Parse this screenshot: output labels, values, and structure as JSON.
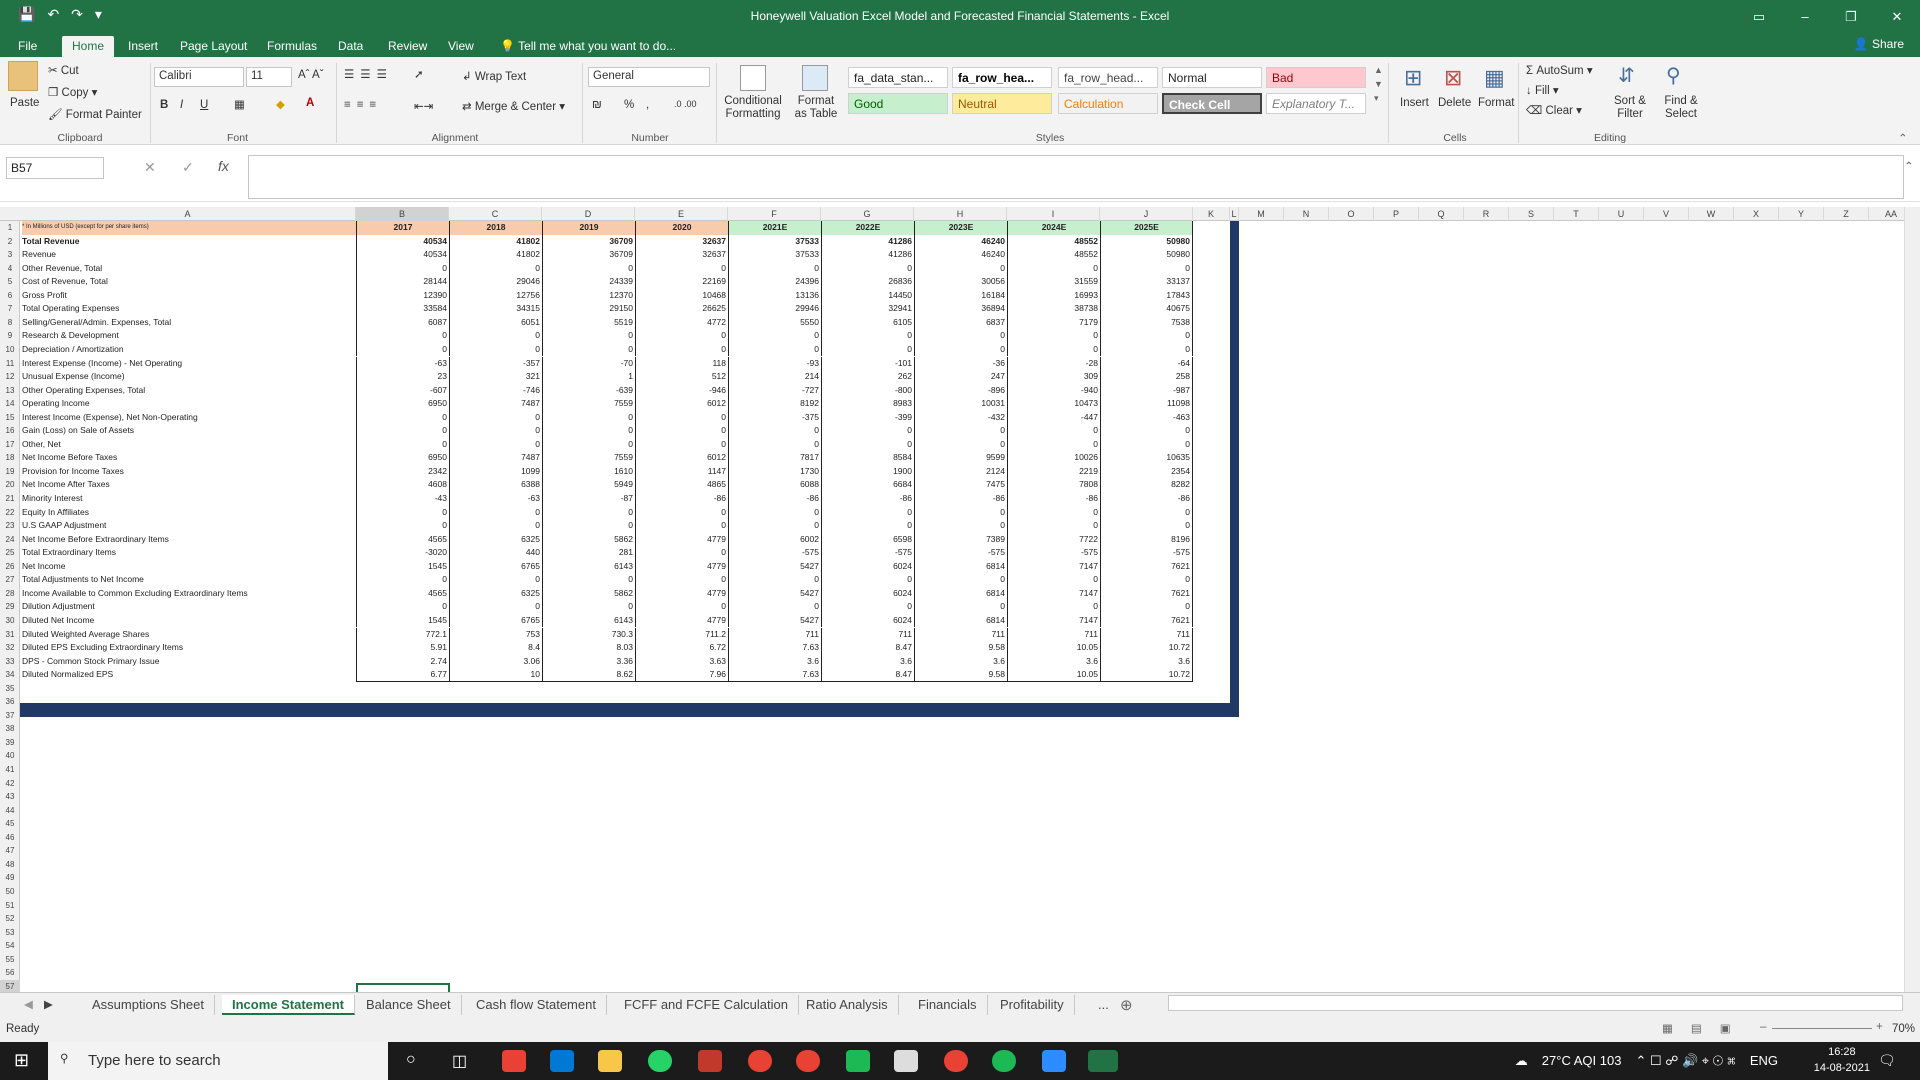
{
  "window": {
    "title": "Honeywell Valuation Excel Model and Forecasted Financial Statements - Excel",
    "share": "Share"
  },
  "ribbon_tabs": [
    "File",
    "Home",
    "Insert",
    "Page Layout",
    "Formulas",
    "Data",
    "Review",
    "View",
    "Tell me what you want to do..."
  ],
  "ribbon": {
    "clipboard": {
      "paste": "Paste",
      "cut": "Cut",
      "copy": "Copy",
      "format_painter": "Format Painter",
      "label": "Clipboard"
    },
    "font": {
      "name": "Calibri",
      "size": "11",
      "label": "Font"
    },
    "alignment": {
      "wrap": "Wrap Text",
      "merge": "Merge & Center",
      "label": "Alignment"
    },
    "number": {
      "format": "General",
      "label": "Number"
    },
    "styles": {
      "conditional": "Conditional Formatting",
      "format_table": "Format as Table",
      "cells": [
        {
          "text": "fa_data_stan...",
          "bg": "#ffffff",
          "fg": "#222222"
        },
        {
          "text": "fa_row_hea...",
          "bg": "#ffffff",
          "fg": "#000000"
        },
        {
          "text": "fa_row_head...",
          "bg": "#ffffff",
          "fg": "#444444"
        },
        {
          "text": "Normal",
          "bg": "#ffffff",
          "fg": "#222222"
        },
        {
          "text": "Bad",
          "bg": "#ffc7ce",
          "fg": "#9c0006"
        },
        {
          "text": "Good",
          "bg": "#c6efce",
          "fg": "#006100"
        },
        {
          "text": "Neutral",
          "bg": "#ffeb9c",
          "fg": "#9c5700"
        },
        {
          "text": "Calculation",
          "bg": "#f2f2f2",
          "fg": "#fa7d00"
        },
        {
          "text": "Check Cell",
          "bg": "#a5a5a5",
          "fg": "#ffffff"
        },
        {
          "text": "Explanatory T...",
          "bg": "#ffffff",
          "fg": "#7f7f7f"
        }
      ],
      "label": "Styles"
    },
    "cells": {
      "insert": "Insert",
      "delete": "Delete",
      "format": "Format",
      "label": "Cells"
    },
    "editing": {
      "autosum": "AutoSum",
      "fill": "Fill",
      "clear": "Clear",
      "sort": "Sort & Filter",
      "find": "Find & Select",
      "label": "Editing"
    }
  },
  "name_box": "B57",
  "columns": [
    "A",
    "B",
    "C",
    "D",
    "E",
    "F",
    "G",
    "H",
    "I",
    "J",
    "K",
    "L",
    "M",
    "N",
    "O",
    "P",
    "Q",
    "R",
    "S",
    "T",
    "U",
    "V",
    "W",
    "X",
    "Y",
    "Z",
    "AA"
  ],
  "table": {
    "note": "* In Millions of USD (except for per share items)",
    "years": [
      "2017",
      "2018",
      "2019",
      "2020",
      "2021E",
      "2022E",
      "2023E",
      "2024E",
      "2025E"
    ],
    "rows": [
      {
        "label": "Total Revenue",
        "values": [
          "40534",
          "41802",
          "36709",
          "32637",
          "37533",
          "41286",
          "46240",
          "48552",
          "50980"
        ],
        "bold": true
      },
      {
        "label": "Revenue",
        "values": [
          "40534",
          "41802",
          "36709",
          "32637",
          "37533",
          "41286",
          "46240",
          "48552",
          "50980"
        ]
      },
      {
        "label": "Other Revenue, Total",
        "values": [
          "0",
          "0",
          "0",
          "0",
          "0",
          "0",
          "0",
          "0",
          "0"
        ]
      },
      {
        "label": "Cost of Revenue, Total",
        "values": [
          "28144",
          "29046",
          "24339",
          "22169",
          "24396",
          "26836",
          "30056",
          "31559",
          "33137"
        ]
      },
      {
        "label": "Gross Profit",
        "values": [
          "12390",
          "12756",
          "12370",
          "10468",
          "13136",
          "14450",
          "16184",
          "16993",
          "17843"
        ]
      },
      {
        "label": "Total Operating Expenses",
        "values": [
          "33584",
          "34315",
          "29150",
          "26625",
          "29946",
          "32941",
          "36894",
          "38738",
          "40675"
        ]
      },
      {
        "label": "Selling/General/Admin. Expenses, Total",
        "values": [
          "6087",
          "6051",
          "5519",
          "4772",
          "5550",
          "6105",
          "6837",
          "7179",
          "7538"
        ]
      },
      {
        "label": "Research & Development",
        "values": [
          "0",
          "0",
          "0",
          "0",
          "0",
          "0",
          "0",
          "0",
          "0"
        ]
      },
      {
        "label": "Depreciation / Amortization",
        "values": [
          "0",
          "0",
          "0",
          "0",
          "0",
          "0",
          "0",
          "0",
          "0"
        ]
      },
      {
        "label": "Interest Expense (Income) - Net Operating",
        "values": [
          "-63",
          "-357",
          "-70",
          "118",
          "-93",
          "-101",
          "-36",
          "-28",
          "-64"
        ]
      },
      {
        "label": "Unusual Expense (Income)",
        "values": [
          "23",
          "321",
          "1",
          "512",
          "214",
          "262",
          "247",
          "309",
          "258"
        ]
      },
      {
        "label": "Other Operating Expenses, Total",
        "values": [
          "-607",
          "-746",
          "-639",
          "-946",
          "-727",
          "-800",
          "-896",
          "-940",
          "-987"
        ]
      },
      {
        "label": "Operating Income",
        "values": [
          "6950",
          "7487",
          "7559",
          "6012",
          "8192",
          "8983",
          "10031",
          "10473",
          "11098"
        ]
      },
      {
        "label": "Interest Income (Expense), Net Non-Operating",
        "values": [
          "0",
          "0",
          "0",
          "0",
          "-375",
          "-399",
          "-432",
          "-447",
          "-463"
        ]
      },
      {
        "label": "Gain (Loss) on Sale of Assets",
        "values": [
          "0",
          "0",
          "0",
          "0",
          "0",
          "0",
          "0",
          "0",
          "0"
        ]
      },
      {
        "label": "Other, Net",
        "values": [
          "0",
          "0",
          "0",
          "0",
          "0",
          "0",
          "0",
          "0",
          "0"
        ]
      },
      {
        "label": "Net Income Before Taxes",
        "values": [
          "6950",
          "7487",
          "7559",
          "6012",
          "7817",
          "8584",
          "9599",
          "10026",
          "10635"
        ]
      },
      {
        "label": "Provision for Income Taxes",
        "values": [
          "2342",
          "1099",
          "1610",
          "1147",
          "1730",
          "1900",
          "2124",
          "2219",
          "2354"
        ]
      },
      {
        "label": "Net Income After Taxes",
        "values": [
          "4608",
          "6388",
          "5949",
          "4865",
          "6088",
          "6684",
          "7475",
          "7808",
          "8282"
        ]
      },
      {
        "label": "Minority Interest",
        "values": [
          "-43",
          "-63",
          "-87",
          "-86",
          "-86",
          "-86",
          "-86",
          "-86",
          "-86"
        ]
      },
      {
        "label": "Equity In Affiliates",
        "values": [
          "0",
          "0",
          "0",
          "0",
          "0",
          "0",
          "0",
          "0",
          "0"
        ]
      },
      {
        "label": "U.S GAAP Adjustment",
        "values": [
          "0",
          "0",
          "0",
          "0",
          "0",
          "0",
          "0",
          "0",
          "0"
        ]
      },
      {
        "label": "Net Income Before Extraordinary Items",
        "values": [
          "4565",
          "6325",
          "5862",
          "4779",
          "6002",
          "6598",
          "7389",
          "7722",
          "8196"
        ]
      },
      {
        "label": "Total Extraordinary Items",
        "values": [
          "-3020",
          "440",
          "281",
          "0",
          "-575",
          "-575",
          "-575",
          "-575",
          "-575"
        ]
      },
      {
        "label": "Net Income",
        "values": [
          "1545",
          "6765",
          "6143",
          "4779",
          "5427",
          "6024",
          "6814",
          "7147",
          "7621"
        ]
      },
      {
        "label": "Total Adjustments to Net Income",
        "values": [
          "0",
          "0",
          "0",
          "0",
          "0",
          "0",
          "0",
          "0",
          "0"
        ]
      },
      {
        "label": "Income Available to Common Excluding Extraordinary Items",
        "values": [
          "4565",
          "6325",
          "5862",
          "4779",
          "5427",
          "6024",
          "6814",
          "7147",
          "7621"
        ]
      },
      {
        "label": "Dilution Adjustment",
        "values": [
          "0",
          "0",
          "0",
          "0",
          "0",
          "0",
          "0",
          "0",
          "0"
        ]
      },
      {
        "label": "Diluted Net Income",
        "values": [
          "1545",
          "6765",
          "6143",
          "4779",
          "5427",
          "6024",
          "6814",
          "7147",
          "7621"
        ]
      },
      {
        "label": "Diluted Weighted Average Shares",
        "values": [
          "772.1",
          "753",
          "730.3",
          "711.2",
          "711",
          "711",
          "711",
          "711",
          "711"
        ]
      },
      {
        "label": "Diluted EPS Excluding Extraordinary Items",
        "values": [
          "5.91",
          "8.4",
          "8.03",
          "6.72",
          "7.63",
          "8.47",
          "9.58",
          "10.05",
          "10.72"
        ]
      },
      {
        "label": "DPS - Common Stock Primary Issue",
        "values": [
          "2.74",
          "3.06",
          "3.36",
          "3.63",
          "3.6",
          "3.6",
          "3.6",
          "3.6",
          "3.6"
        ]
      },
      {
        "label": "Diluted Normalized EPS",
        "values": [
          "6.77",
          "10",
          "8.62",
          "7.96",
          "7.63",
          "8.47",
          "9.58",
          "10.05",
          "10.72"
        ]
      }
    ]
  },
  "sheet_tabs": [
    "Assumptions Sheet",
    "Income Statement",
    "Balance Sheet",
    "Cash flow Statement",
    "FCFF and FCFE Calculation",
    "Ratio Analysis",
    "Financials",
    "Profitability",
    "..."
  ],
  "status": {
    "ready": "Ready",
    "zoom": "70%"
  },
  "taskbar": {
    "search": "Type here to search",
    "weather": "27°C  AQI 103",
    "lang": "ENG",
    "time": "16:28",
    "date": "14-08-2021"
  }
}
